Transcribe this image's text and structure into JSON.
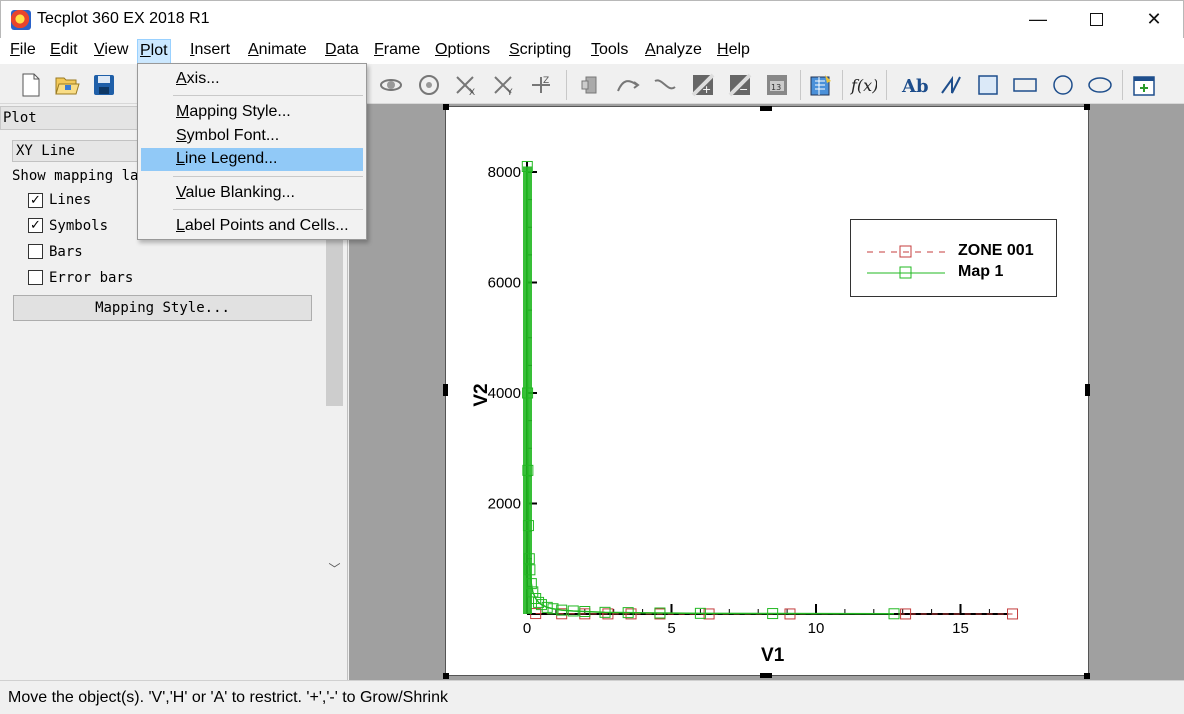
{
  "window": {
    "title": "Tecplot 360 EX 2018 R1",
    "minimize": "—",
    "close": "✕"
  },
  "menubar": {
    "items": [
      {
        "u": "F",
        "rest": "ile"
      },
      {
        "u": "E",
        "rest": "dit"
      },
      {
        "u": "V",
        "rest": "iew"
      },
      {
        "u": "P",
        "rest": "lot"
      },
      {
        "u": "I",
        "rest": "nsert"
      },
      {
        "u": "A",
        "rest": "nimate"
      },
      {
        "u": "D",
        "rest": "ata"
      },
      {
        "u": "F",
        "rest": "rame"
      },
      {
        "u": "O",
        "rest": "ptions"
      },
      {
        "u": "S",
        "rest": "cripting"
      },
      {
        "u": "T",
        "rest": "ools"
      },
      {
        "u": "A",
        "rest": "nalyze"
      },
      {
        "u": "H",
        "rest": "elp"
      }
    ]
  },
  "plot_menu": {
    "items": [
      {
        "u": "A",
        "rest": "xis..."
      },
      {
        "u": "M",
        "rest": "apping Style..."
      },
      {
        "u": "S",
        "rest": "ymbol Font..."
      },
      {
        "u": "L",
        "rest": "ine Legend..."
      },
      {
        "u": "V",
        "rest": "alue Blanking..."
      },
      {
        "u": "L",
        "rest": "abel Points and Cells..."
      }
    ],
    "highlighted": "Line Legend..."
  },
  "sidebar": {
    "title": "Plot",
    "plot_type": "XY Line",
    "layers_label": "Show mapping lay",
    "layers": [
      {
        "label": "Lines",
        "checked": true
      },
      {
        "label": "Symbols",
        "checked": true
      },
      {
        "label": "Bars",
        "checked": false
      },
      {
        "label": "Error bars",
        "checked": false
      }
    ],
    "mapping_button": "Mapping Style..."
  },
  "statusbar": {
    "text": "Move the object(s).  'V','H' or 'A' to restrict.  '+','-' to Grow/Shrink"
  },
  "legend": {
    "entries": [
      {
        "name": "ZONE 001",
        "color": "#c43c3c",
        "dash": true
      },
      {
        "name": "Map 1",
        "color": "#22b822",
        "dash": false
      }
    ]
  },
  "toolbar_icons": [
    "new-layout-icon",
    "open-layout-icon",
    "save-layout-icon",
    "rotate-icon",
    "rotate-spherical-icon",
    "translate-x-icon",
    "translate-y-icon",
    "translate-z-icon",
    "probe-icon",
    "contour-add-icon",
    "contour-remove-icon",
    "slice-icon",
    "streamtrace-icon",
    "zone-style-icon",
    "equation-icon",
    "text-icon",
    "polyline-icon",
    "square-icon",
    "rectangle-icon",
    "circle-icon",
    "ellipse-icon",
    "add-frame-icon"
  ],
  "chart_data": {
    "type": "line",
    "xlabel": "V1",
    "ylabel": "V2",
    "xticks": [
      0,
      5,
      10,
      15
    ],
    "yticks": [
      2000,
      4000,
      6000,
      8000
    ],
    "xlim": [
      0,
      17
    ],
    "ylim": [
      0,
      8200
    ],
    "series": [
      {
        "name": "ZONE 001",
        "color": "#c43c3c",
        "style": "dashed",
        "symbol": "square",
        "x": [
          0.3,
          1.2,
          2.0,
          2.8,
          3.6,
          4.6,
          6.3,
          9.1,
          13.1,
          16.8
        ],
        "y": [
          8,
          4,
          3,
          2,
          2,
          1,
          1,
          1,
          1,
          1
        ]
      },
      {
        "name": "Map 1",
        "color": "#22b822",
        "style": "solid",
        "symbol": "square",
        "x": [
          0.01,
          0.02,
          0.03,
          0.05,
          0.08,
          0.1,
          0.15,
          0.2,
          0.3,
          0.4,
          0.5,
          0.7,
          0.9,
          1.2,
          1.6,
          2.0,
          2.7,
          3.5,
          4.6,
          6.0,
          8.5,
          12.7
        ],
        "y": [
          8100,
          4000,
          2600,
          1600,
          1000,
          800,
          550,
          400,
          280,
          210,
          170,
          120,
          95,
          70,
          55,
          45,
          30,
          25,
          18,
          12,
          8,
          4
        ]
      }
    ]
  }
}
